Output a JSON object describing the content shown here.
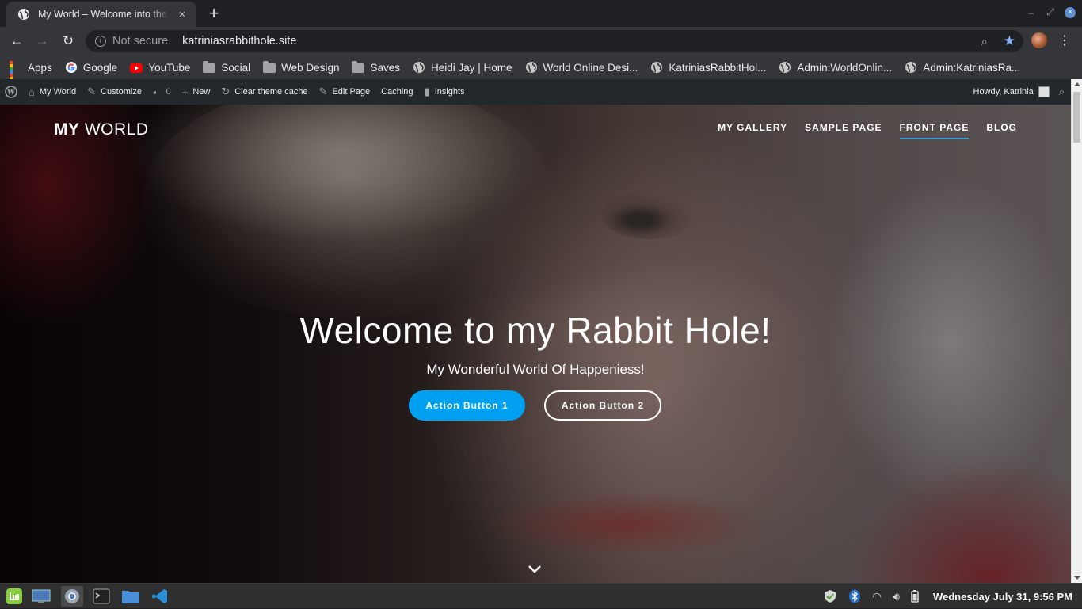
{
  "browser": {
    "tab_title": "My World – Welcome into the Rabbit Hole!",
    "new_tab_icon": "+",
    "tab_close_icon": "×",
    "security_label": "Not secure",
    "url": "katriniasrabbithole.site"
  },
  "bookmarks": [
    {
      "label": "Apps",
      "icon": "apps-grid-icon"
    },
    {
      "label": "Google",
      "icon": "google-icon"
    },
    {
      "label": "YouTube",
      "icon": "youtube-icon"
    },
    {
      "label": "Social",
      "icon": "folder-icon"
    },
    {
      "label": "Web Design",
      "icon": "folder-icon"
    },
    {
      "label": "Saves",
      "icon": "folder-icon"
    },
    {
      "label": "Heidi Jay | Home",
      "icon": "globe-icon"
    },
    {
      "label": "World Online Desi...",
      "icon": "globe-icon"
    },
    {
      "label": "KatriniasRabbitHol...",
      "icon": "globe-icon"
    },
    {
      "label": "Admin:WorldOnlin...",
      "icon": "globe-icon"
    },
    {
      "label": "Admin:KatriniasRa...",
      "icon": "globe-icon"
    }
  ],
  "wp_admin_bar": {
    "site_name": "My World",
    "customize": "Customize",
    "comments_count": "0",
    "new": "New",
    "clear_cache": "Clear theme cache",
    "edit_page": "Edit Page",
    "caching": "Caching",
    "insights": "Insights",
    "howdy": "Howdy, Katrinia"
  },
  "site": {
    "title_bold": "MY",
    "title_light": "WORLD",
    "nav": [
      {
        "label": "MY GALLERY",
        "active": false
      },
      {
        "label": "SAMPLE PAGE",
        "active": false
      },
      {
        "label": "FRONT PAGE",
        "active": true
      },
      {
        "label": "BLOG",
        "active": false
      }
    ],
    "accent_color": "#25a7e0"
  },
  "hero": {
    "title": "Welcome to my Rabbit Hole!",
    "subtitle": "My Wonderful World Of Happeniess!",
    "button1": "Action Button 1",
    "button2": "Action Button 2",
    "button1_color": "#00a0f0"
  },
  "taskbar": {
    "clock": "Wednesday July 31,  9:56 PM"
  }
}
